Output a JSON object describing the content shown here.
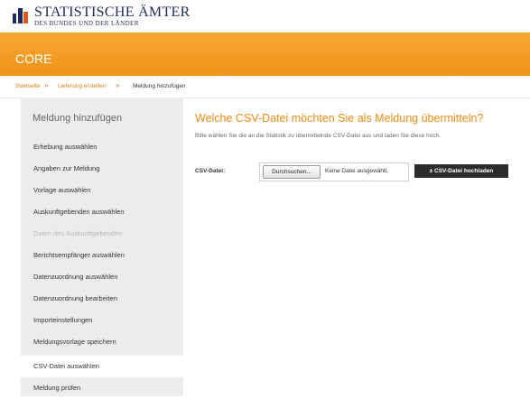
{
  "header": {
    "logo_title": "STATISTISCHE ÄMTER",
    "logo_subtitle": "DES BUNDES UND DER LÄNDER",
    "app_name": "CORE"
  },
  "breadcrumb": {
    "items": [
      {
        "label": "Startseite",
        "type": "link"
      },
      {
        "label": "Lieferung erstellen",
        "type": "link"
      },
      {
        "label": "Meldung hinzufügen",
        "type": "current"
      }
    ],
    "separator": "»"
  },
  "sidebar": {
    "title": "Meldung hinzufügen",
    "items": [
      {
        "label": "Erhebung auswählen",
        "state": "normal"
      },
      {
        "label": "Angaben zur Meldung",
        "state": "normal"
      },
      {
        "label": "Vorlage auswählen",
        "state": "normal"
      },
      {
        "label": "Auskunftgebenden auswählen",
        "state": "normal"
      },
      {
        "label": "Daten des Auskunftgebenden",
        "state": "disabled"
      },
      {
        "label": "Berichtsempfänger auswählen",
        "state": "normal"
      },
      {
        "label": "Datenzuordnung auswählen",
        "state": "normal"
      },
      {
        "label": "Datenzuordnung bearbeiten",
        "state": "normal"
      },
      {
        "label": "Importeinstellungen",
        "state": "normal"
      },
      {
        "label": "Meldungsvorlage speichern",
        "state": "normal"
      },
      {
        "label": "CSV-Datei auswählen",
        "state": "active"
      },
      {
        "label": "Meldung prüfen",
        "state": "normal"
      }
    ]
  },
  "main": {
    "title": "Welche CSV-Datei möchten Sie als Meldung übermitteln?",
    "description": "Bitte wählen Sie die an die Statistik zu übermittelnde CSV-Datei aus und laden Sie diese hoch.",
    "csv_label": "CSV-Datei:",
    "browse_label": "Durchsuchen...",
    "no_file_text": "Keine Datei ausgewählt.",
    "upload_label": "± CSV-Datei hochladen"
  },
  "colors": {
    "brand_orange": "#f0931a",
    "title_orange": "#f08a16",
    "logo_navy": "#1f2a5c",
    "sidebar_bg": "#ececec"
  }
}
